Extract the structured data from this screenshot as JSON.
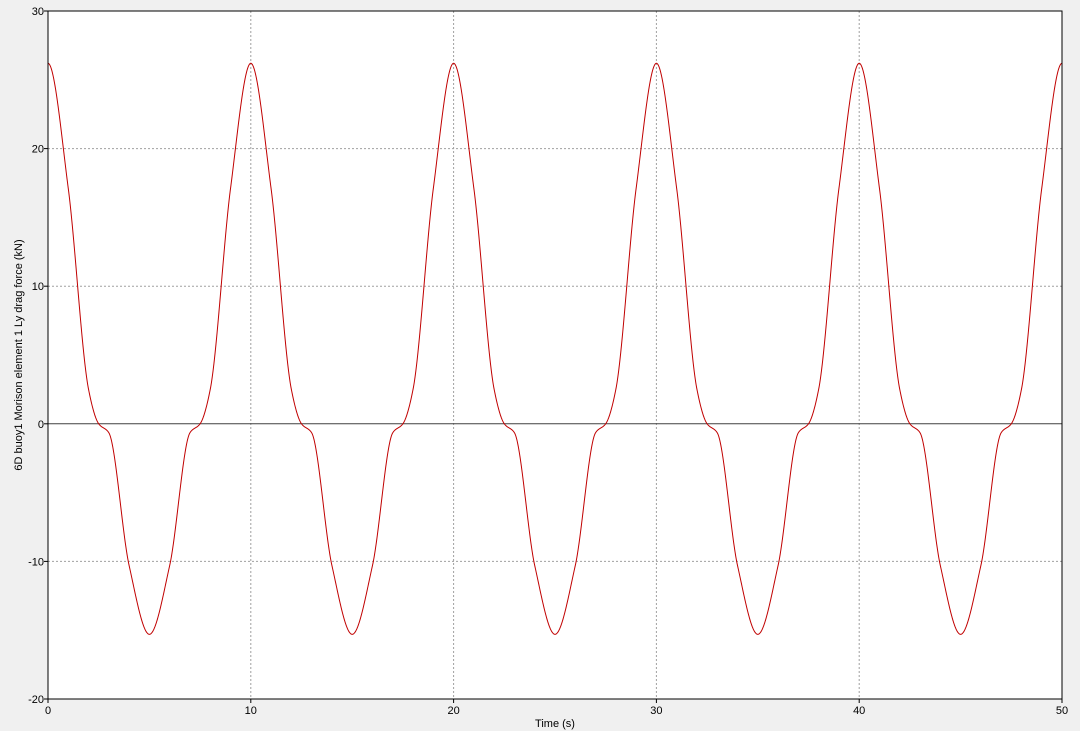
{
  "chart_data": {
    "type": "line",
    "xlabel": "Time (s)",
    "ylabel": "6D buoy1 Morison element 1 Ly drag force (kN)",
    "xlim": [
      0,
      50
    ],
    "ylim": [
      -20,
      30
    ],
    "xticks": [
      0,
      10,
      20,
      30,
      40,
      50
    ],
    "yticks": [
      -20,
      -10,
      0,
      10,
      20,
      30
    ],
    "grid": true,
    "grid_style": "dotted",
    "zero_line": true,
    "period_s": 10,
    "series": [
      {
        "color": "#c00000",
        "x": [
          0,
          1,
          2,
          2.5,
          3,
          4,
          5,
          6,
          7,
          7.5,
          8,
          9,
          10
        ],
        "y": [
          26.2,
          17.1,
          2.5,
          0,
          -0.65,
          -10.3,
          -15.3,
          -10.3,
          -0.65,
          0,
          2.5,
          17.1,
          26.2
        ],
        "repeat_every": 10,
        "x_end": 50
      }
    ]
  },
  "colors": {
    "background": "#f0f0f0",
    "plot_area": "#ffffff",
    "series": "#c00000",
    "grid": "#a0a0a0",
    "zero_line": "#404040",
    "frame": "#000000"
  }
}
